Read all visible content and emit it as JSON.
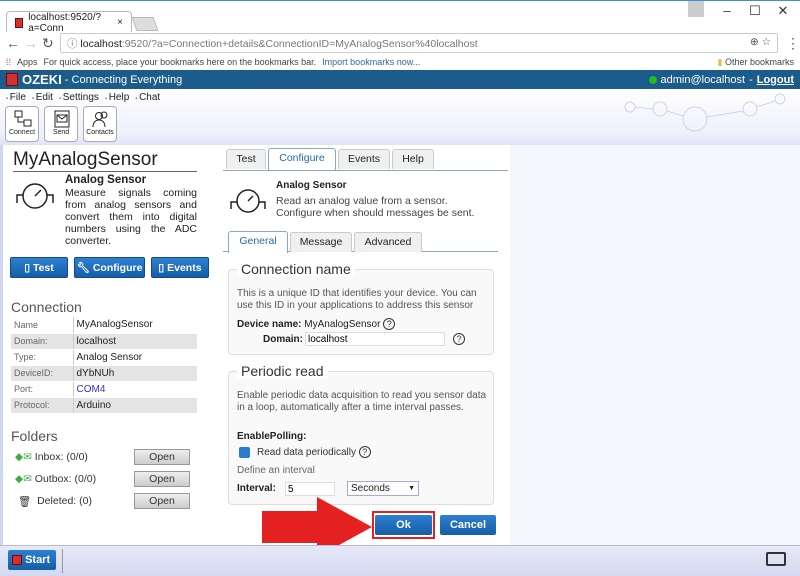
{
  "browser": {
    "tab_title": "localhost:9520/?a=Conn",
    "url_host": "localhost",
    "url_rest": ":9520/?a=Connection+details&ConnectionID=MyAnalogSensor%40localhost",
    "apps": "Apps",
    "bookmark_hint": "For quick access, place your bookmarks here on the bookmarks bar.",
    "import_link": "Import bookmarks now...",
    "other_bookmarks": "Other bookmarks"
  },
  "header": {
    "logo": "OZEKI",
    "tagline": "- Connecting Everything",
    "user": "admin@localhost",
    "sep": "-",
    "logout": "Logout",
    "bg": "#1b5c8a"
  },
  "menu": [
    "File",
    "Edit",
    "Settings",
    "Help",
    "Chat"
  ],
  "toolbar": [
    {
      "label": "Connect",
      "icon": "connect-icon"
    },
    {
      "label": "Send",
      "icon": "send-icon"
    },
    {
      "label": "Contacts",
      "icon": "contacts-icon"
    }
  ],
  "left": {
    "title": "MyAnalogSensor",
    "type_title": "Analog Sensor",
    "description": "Measure signals coming from analog sensors and convert them into digital numbers using the ADC converter.",
    "buttons": [
      "Test",
      "Configure",
      "Events"
    ],
    "connection_heading": "Connection",
    "connection": [
      [
        "Name",
        "MyAnalogSensor"
      ],
      [
        "Domain:",
        "localhost"
      ],
      [
        "Type:",
        "Analog Sensor"
      ],
      [
        "DeviceID:",
        "dYbNUh"
      ],
      [
        "Port:",
        "COM4"
      ],
      [
        "Protocol:",
        "Arduino"
      ]
    ],
    "folders_heading": "Folders",
    "folders": [
      {
        "name": "Inbox:",
        "count": "(0/0)",
        "button": "Open"
      },
      {
        "name": "Outbox:",
        "count": "(0/0)",
        "button": "Open"
      },
      {
        "name": "Deleted:",
        "count": "(0)",
        "button": "Open"
      }
    ]
  },
  "right": {
    "tabs": [
      "Test",
      "Configure",
      "Events",
      "Help"
    ],
    "active_tab": "Configure",
    "title": "Analog Sensor",
    "description": "Read an analog value from a sensor. Configure when should messages be sent.",
    "subtabs": [
      "General",
      "Message",
      "Advanced"
    ],
    "active_subtab": "General",
    "conn_name": {
      "legend": "Connection name",
      "text": "This is a unique ID that identifies your device. You can use this ID in your applications to address this sensor",
      "device_label": "Device name:",
      "device_value": "MyAnalogSensor",
      "domain_label": "Domain:",
      "domain_value": "localhost"
    },
    "periodic": {
      "legend": "Periodic read",
      "text": "Enable periodic data acquisition to read you sensor data in a loop, automatically after a time interval passes.",
      "enable_label": "EnablePolling:",
      "checkbox_label": "Read data periodically",
      "checked": true,
      "interval_hint": "Define an interval",
      "interval_label": "Interval:",
      "interval_value": "5",
      "unit": "Seconds"
    },
    "ok": "Ok",
    "cancel": "Cancel",
    "help_glyph": "?"
  },
  "taskbar": {
    "start": "Start"
  }
}
